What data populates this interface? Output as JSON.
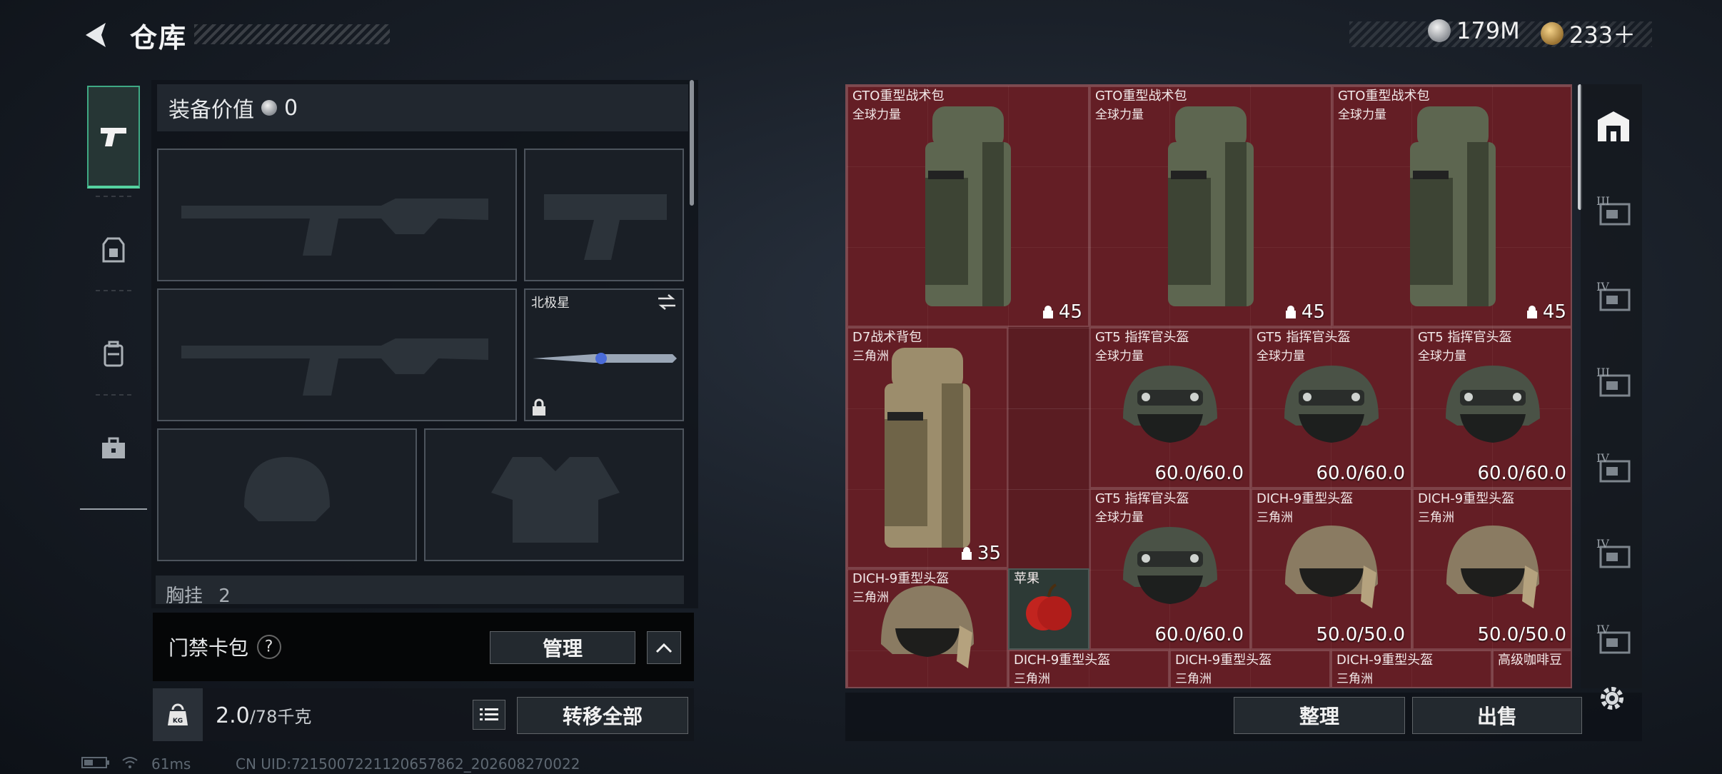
{
  "header": {
    "title": "仓库"
  },
  "currency": {
    "silver": "179M",
    "gold": "233＋"
  },
  "equipment": {
    "value_label": "装备价值",
    "value": "0",
    "melee_name": "北极星",
    "chest_label": "胸挂",
    "chest_count": "2"
  },
  "access_card": {
    "label": "门禁卡包",
    "help": "?",
    "manage": "管理"
  },
  "weight": {
    "current": "2.0",
    "capacity": "/78千克",
    "transfer_all": "转移全部",
    "kg_badge": "KG"
  },
  "stash": {
    "items": [
      {
        "name": "GTO重型战术包",
        "sub": "全球力量",
        "value": "45",
        "kind": "backpack"
      },
      {
        "name": "GTO重型战术包",
        "sub": "全球力量",
        "value": "45",
        "kind": "backpack"
      },
      {
        "name": "GTO重型战术包",
        "sub": "全球力量",
        "value": "45",
        "kind": "backpack"
      },
      {
        "name": "D7战术背包",
        "sub": "三角洲",
        "value": "35",
        "kind": "backpack-tan"
      },
      {
        "name": "GT5 指挥官头盔",
        "sub": "全球力量",
        "value": "60.0/60.0",
        "kind": "helmet"
      },
      {
        "name": "GT5 指挥官头盔",
        "sub": "全球力量",
        "value": "60.0/60.0",
        "kind": "helmet"
      },
      {
        "name": "GT5 指挥官头盔",
        "sub": "全球力量",
        "value": "60.0/60.0",
        "kind": "helmet"
      },
      {
        "name": "GT5 指挥官头盔",
        "sub": "全球力量",
        "value": "60.0/60.0",
        "kind": "helmet"
      },
      {
        "name": "DICH-9重型头盔",
        "sub": "三角洲",
        "value": "50.0/50.0",
        "kind": "helmet-tan"
      },
      {
        "name": "DICH-9重型头盔",
        "sub": "三角洲",
        "value": "50.0/50.0",
        "kind": "helmet-tan"
      },
      {
        "name": "DICH-9重型头盔",
        "sub": "三角洲",
        "value": "",
        "kind": "helmet-tan"
      },
      {
        "name": "苹果",
        "sub": "",
        "value": "",
        "kind": "apple"
      },
      {
        "name": "DICH-9重型头盔",
        "sub": "三角洲",
        "value": "",
        "kind": "helmet-tan"
      },
      {
        "name": "DICH-9重型头盔",
        "sub": "三角洲",
        "value": "",
        "kind": "helmet-tan"
      },
      {
        "name": "DICH-9重型头盔",
        "sub": "三角洲",
        "value": "",
        "kind": "helmet-tan"
      },
      {
        "name": "高级咖啡豆",
        "sub": "",
        "value": "",
        "kind": "coffee"
      }
    ],
    "sort_label": "整理",
    "sell_label": "出售"
  },
  "right_rail": [
    "III",
    "IV",
    "III",
    "IV",
    "IV",
    "IV"
  ],
  "status_bar": {
    "ping": "61ms",
    "uid": "CN UID:7215007221120657862_202608270022"
  },
  "colors": {
    "accent": "#55d2a0",
    "stash_bg": "#5a1c22"
  }
}
